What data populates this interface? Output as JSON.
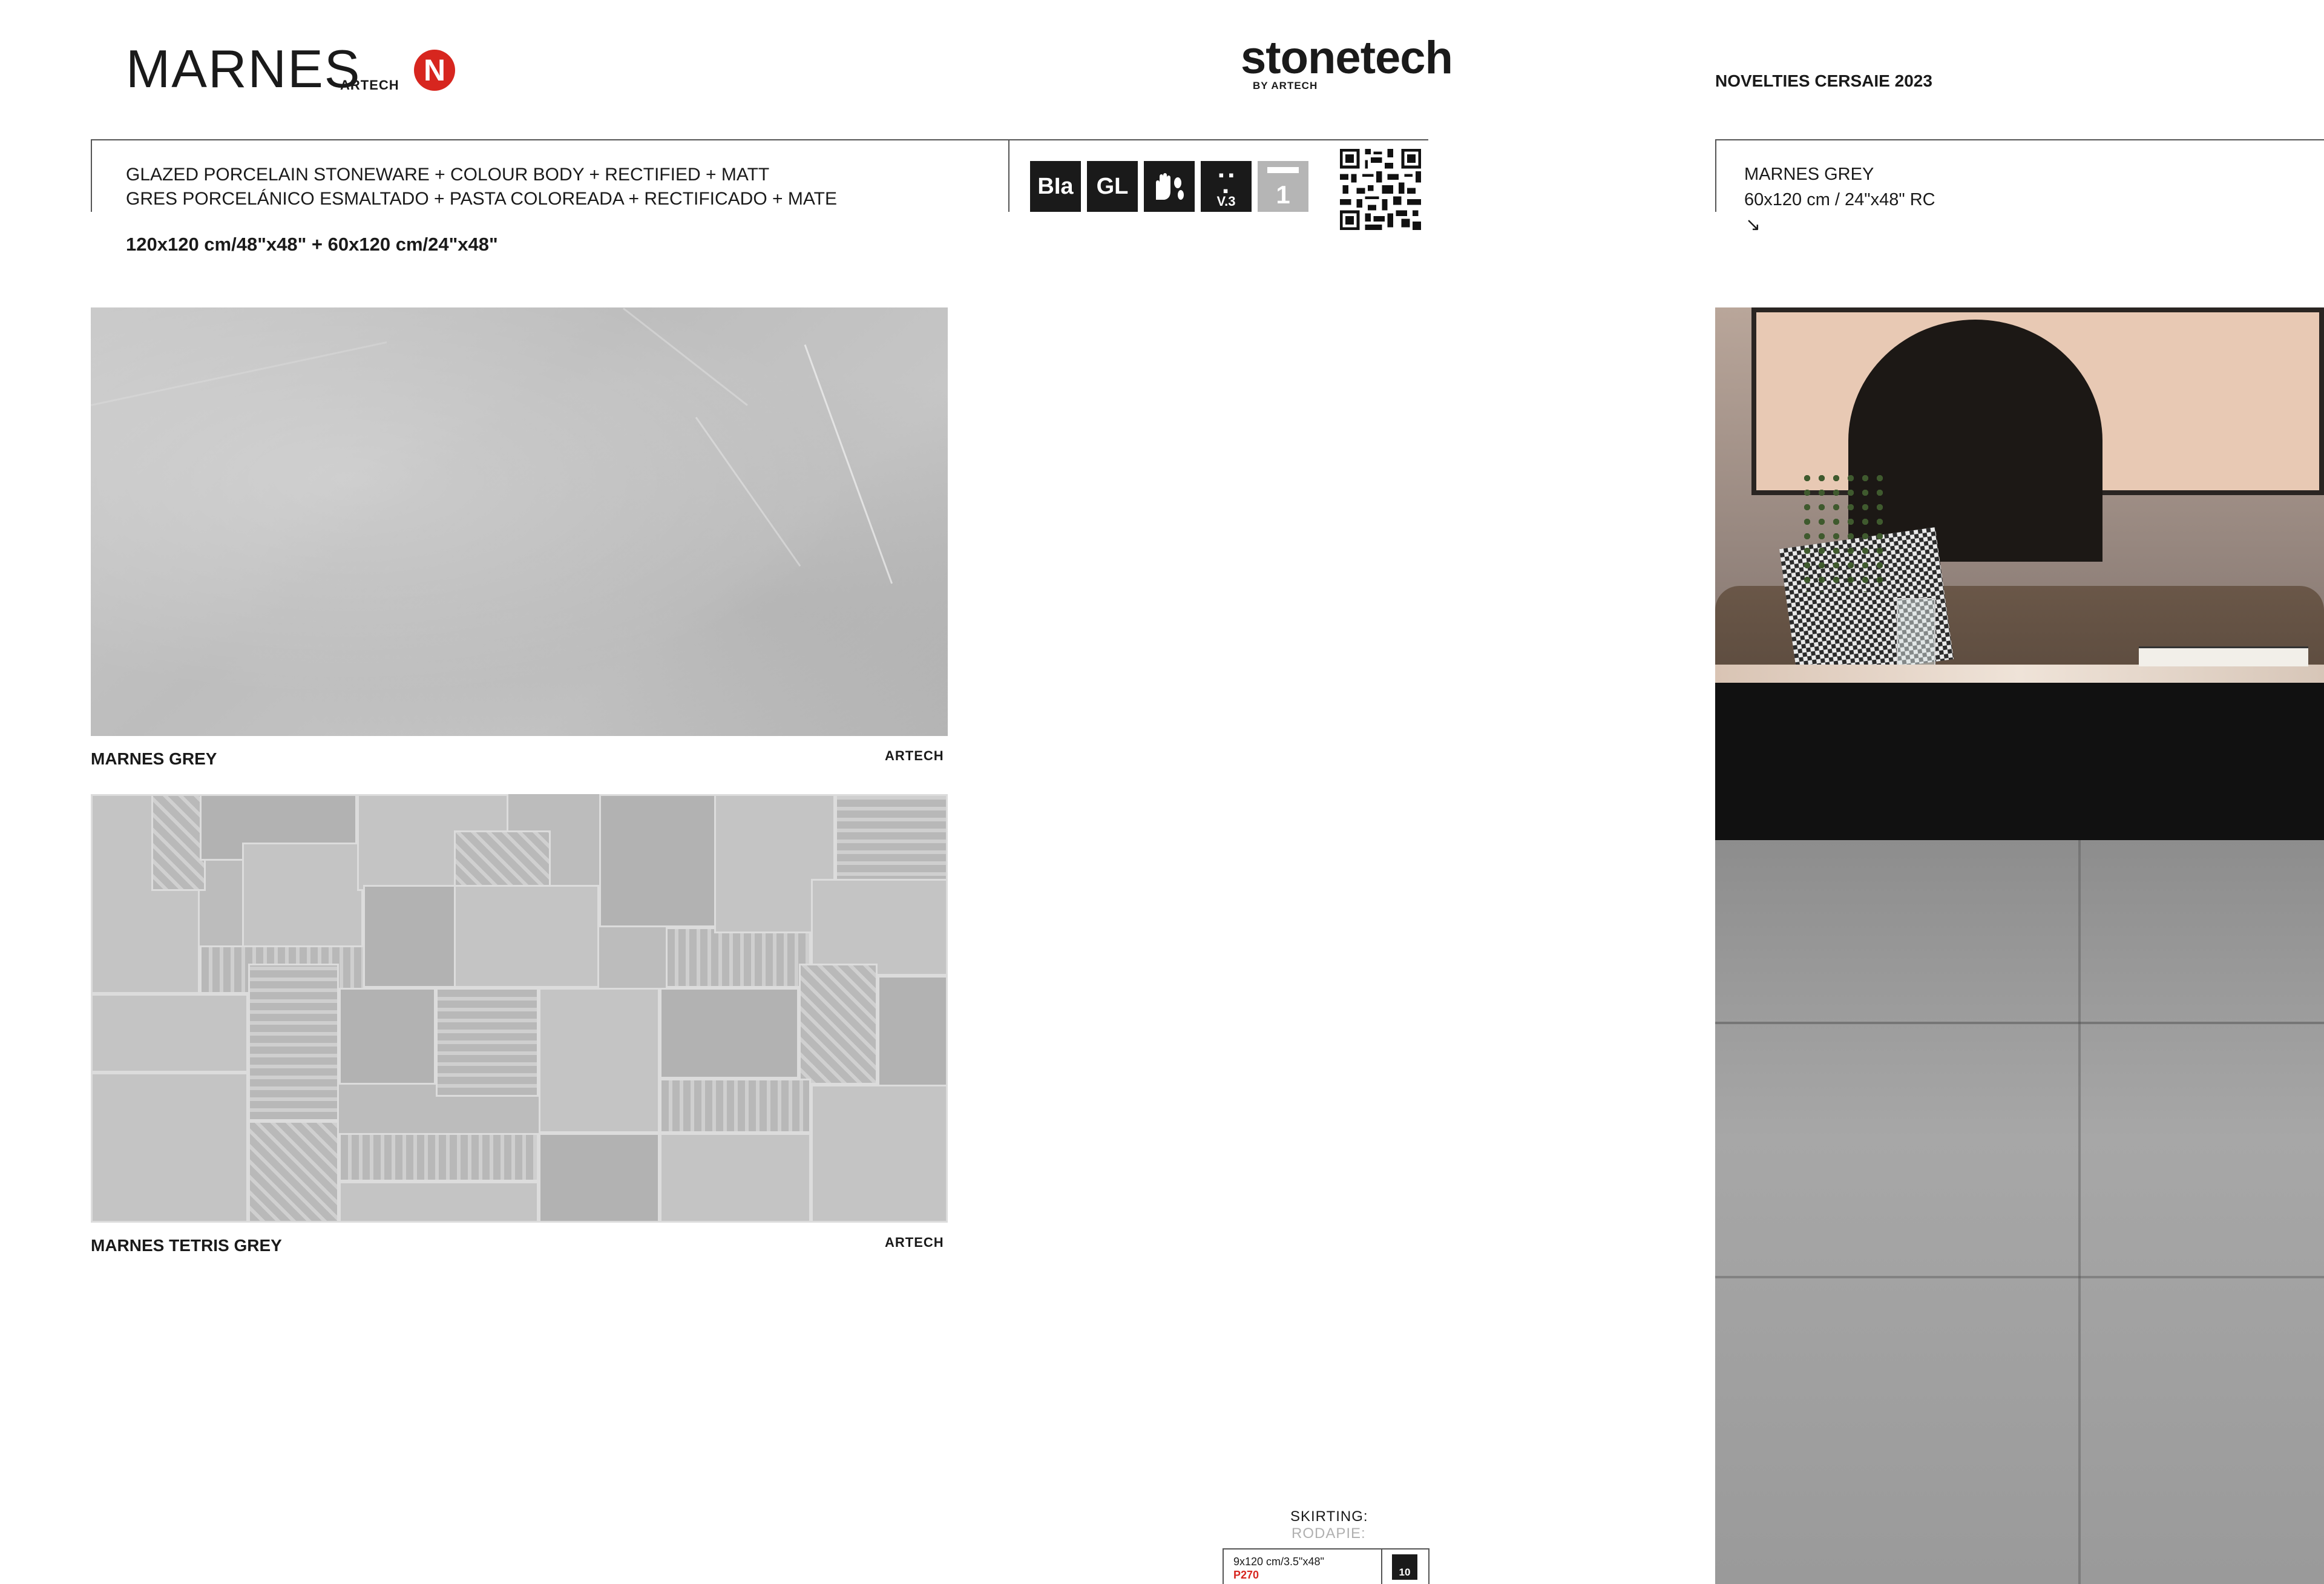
{
  "header": {
    "title": "MARNES",
    "artech": "ARTECH",
    "new_badge": "N",
    "brand": "stonetech",
    "brand_sub": "BY ARTECH",
    "novelties": "NOVELTIES CERSAIE 2023"
  },
  "specs": {
    "line_en": "GLAZED PORCELAIN STONEWARE + COLOUR BODY + RECTIFIED + MATT",
    "line_es": "GRES PORCELÁNICO ESMALTADO + PASTA COLOREADA + RECTIFICADO + MATE",
    "sizes": "120x120 cm/48\"x48\" + 60x120 cm/24\"x48\"",
    "icons": {
      "bla": "BIa",
      "gl": "GL",
      "hand_feet": "hand-feet-icon",
      "v3": "V.3",
      "slip": "1"
    }
  },
  "right_panel": {
    "name": "MARNES GREY",
    "size": "60x120 cm / 24\"x48\" RC",
    "arrow": "↘"
  },
  "products": [
    {
      "name": "MARNES GREY",
      "brand": "ARTECH"
    },
    {
      "name": "MARNES TETRIS GREY",
      "brand": "ARTECH"
    }
  ],
  "skirting": {
    "label_en": "SKIRTING:",
    "label_es": "RODAPIE:",
    "size": "9x120 cm/3.5\"x48\"",
    "code": "P270",
    "qty": "10"
  }
}
